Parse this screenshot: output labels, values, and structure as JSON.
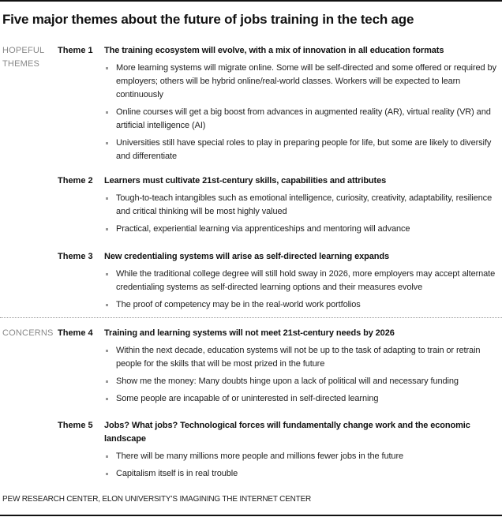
{
  "title": "Five major themes about the future of jobs training in the tech age",
  "categories": [
    {
      "label_line1": "HOPEFUL",
      "label_line2": "THEMES"
    },
    {
      "label_line1": "CONCERNS",
      "label_line2": ""
    }
  ],
  "themes": [
    {
      "number": "Theme 1",
      "heading": "The training ecosystem will evolve,  with a mix of innovation in all education formats",
      "bullets": [
        "More learning systems will migrate online. Some will be self-directed and some offered or required by employers; others will be hybrid online/real-world classes. Workers will be expected to learn continuously",
        "Online courses will get a big boost from advances in augmented reality (AR), virtual reality (VR) and artificial intelligence (AI)",
        "Universities still have special roles to play in preparing people for life, but some are likely to diversify and differentiate"
      ]
    },
    {
      "number": "Theme 2",
      "heading": "Learners must cultivate 21st-century skills, capabilities and attributes",
      "bullets": [
        "Tough-to-teach intangibles such as emotional intelligence, curiosity, creativity, adaptability, resilience and critical thinking will be most highly valued",
        "Practical, experiential learning via apprenticeships and mentoring will advance"
      ]
    },
    {
      "number": "Theme 3",
      "heading": "New credentialing systems will arise as self-directed learning expands",
      "bullets": [
        "While the traditional college degree will still hold sway in 2026, more employers may accept alternate credentialing systems as self-directed learning options and their measures evolve",
        "The proof of competency may be in the real-world work portfolios"
      ]
    },
    {
      "number": "Theme 4",
      "heading": "Training and learning systems will not meet 21st-century needs by 2026",
      "bullets": [
        "Within the next decade, education systems will not be up to the task of adapting to train or retrain people for the skills that will be most prized in the future",
        "Show me the money: Many doubts hinge upon a lack of political will and necessary funding",
        "Some people are incapable of or uninterested in self-directed learning"
      ]
    },
    {
      "number": "Theme 5",
      "heading": "Jobs? What jobs? Technological forces will fundamentally change work and the economic landscape",
      "bullets": [
        "There will be many millions more people and millions fewer jobs in the future",
        "Capitalism itself is in real trouble"
      ]
    }
  ],
  "source": "PEW RESEARCH CENTER, ELON UNIVERSITY’S IMAGINING THE INTERNET CENTER"
}
